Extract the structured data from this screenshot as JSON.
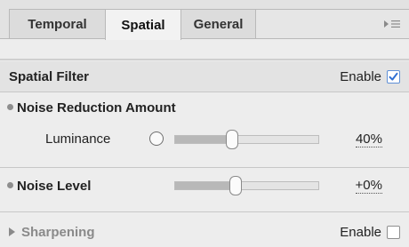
{
  "tabs": [
    {
      "label": "Temporal",
      "active": false
    },
    {
      "label": "Spatial",
      "active": true
    },
    {
      "label": "General",
      "active": false
    }
  ],
  "panel_menu_icon": "panel-menu-icon",
  "spatial_filter": {
    "title": "Spatial Filter",
    "enable_label": "Enable",
    "enabled": true
  },
  "noise_reduction": {
    "title": "Noise Reduction Amount",
    "luminance": {
      "label": "Luminance",
      "value_text": "40%",
      "value": 0.4
    }
  },
  "noise_level": {
    "title": "Noise Level",
    "value_text": "+0%",
    "value": 0.42
  },
  "sharpening": {
    "title": "Sharpening",
    "enable_label": "Enable",
    "enabled": false
  },
  "colors": {
    "accent": "#2f6fd3",
    "panel_bg": "#ededed",
    "section_bg": "#e3e3e3"
  }
}
